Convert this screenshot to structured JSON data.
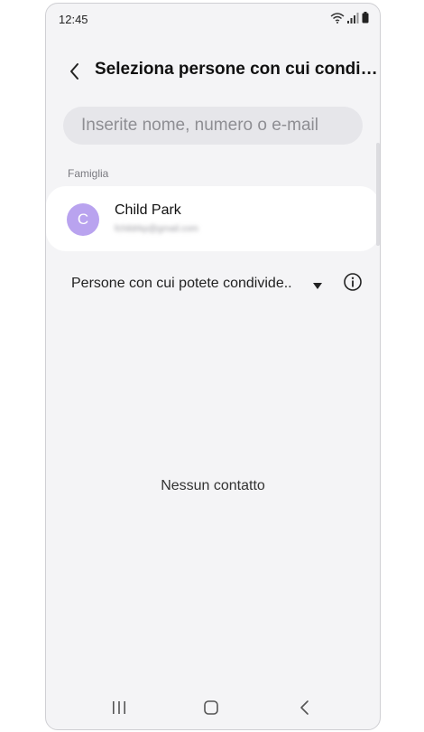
{
  "status_bar": {
    "time": "12:45",
    "icons": [
      "wifi-calling-icon",
      "signal-icon",
      "battery-icon"
    ]
  },
  "header": {
    "title": "Seleziona persone con cui condi…",
    "back_icon": "chevron-left-icon"
  },
  "search": {
    "placeholder": "Inserite nome, numero o e-mail",
    "value": ""
  },
  "family_section": {
    "label": "Famiglia",
    "contacts": [
      {
        "initial": "C",
        "name": "Child Park",
        "detail": "fchildrkp@gmail.com",
        "avatar_color": "#b9a3ef"
      }
    ]
  },
  "filter": {
    "label": "Persone con cui potete condivide..",
    "dropdown_icon": "triangle-down-icon",
    "info_icon": "info-icon"
  },
  "empty_state": {
    "message": "Nessun contatto"
  },
  "nav_bar": {
    "buttons": [
      "recent-apps-icon",
      "home-icon",
      "back-icon"
    ]
  }
}
